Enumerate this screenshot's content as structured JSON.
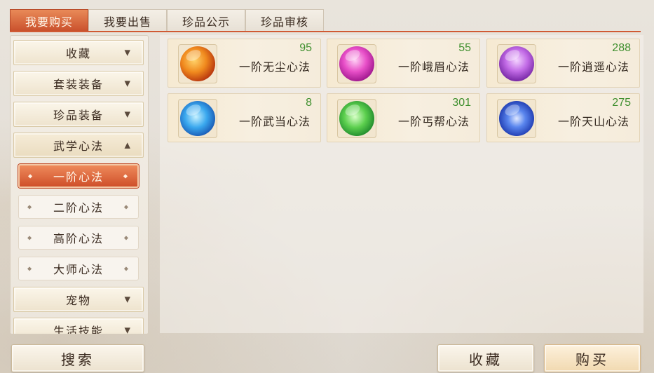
{
  "tabs": [
    {
      "label": "我要购买",
      "active": true
    },
    {
      "label": "我要出售",
      "active": false
    },
    {
      "label": "珍品公示",
      "active": false
    },
    {
      "label": "珍品审核",
      "active": false
    }
  ],
  "sidebar": {
    "categories": [
      {
        "label": "收藏",
        "arrow": "▼"
      },
      {
        "label": "套装装备",
        "arrow": "▼"
      },
      {
        "label": "珍品装备",
        "arrow": "▼"
      },
      {
        "label": "武学心法",
        "arrow": "▲"
      },
      {
        "label": "宠物",
        "arrow": "▼"
      },
      {
        "label": "生活技能",
        "arrow": "▼"
      }
    ],
    "subitems": [
      {
        "label": "一阶心法",
        "active": true
      },
      {
        "label": "二阶心法",
        "active": false
      },
      {
        "label": "高阶心法",
        "active": false
      },
      {
        "label": "大师心法",
        "active": false
      }
    ]
  },
  "items": [
    {
      "name": "一阶无尘心法",
      "count": "95",
      "icon": "fire-sword-icon",
      "color": "#e8701c"
    },
    {
      "name": "一阶峨眉心法",
      "count": "55",
      "icon": "pink-dancer-icon",
      "color": "#d43ab8"
    },
    {
      "name": "一阶逍遥心法",
      "count": "288",
      "icon": "purple-lotus-icon",
      "color": "#b45ad6"
    },
    {
      "name": "一阶武当心法",
      "count": "8",
      "icon": "blue-fighter-icon",
      "color": "#2f8fe0"
    },
    {
      "name": "一阶丐帮心法",
      "count": "301",
      "icon": "green-staff-icon",
      "color": "#3fb04a"
    },
    {
      "name": "一阶天山心法",
      "count": "275",
      "icon": "blue-swirl-icon",
      "color": "#3a6fe8"
    }
  ],
  "buttons": {
    "search": "搜索",
    "favorite": "收藏",
    "buy": "购买"
  },
  "colors": {
    "accent": "#d05a34",
    "count_green": "#3f8f2e"
  }
}
